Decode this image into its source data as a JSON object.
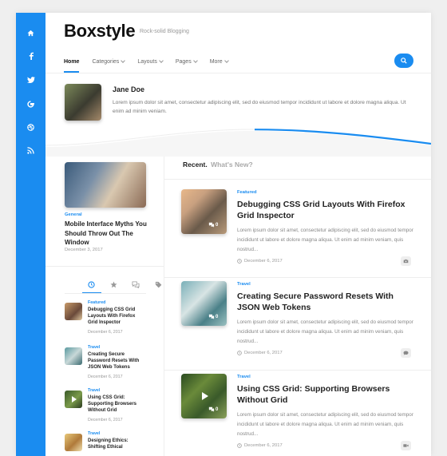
{
  "sidebar": {
    "icons": [
      "home-icon",
      "facebook-icon",
      "twitter-icon",
      "google-plus-icon",
      "dribbble-icon",
      "rss-icon"
    ]
  },
  "header": {
    "logo": "Boxstyle",
    "tagline": "Rock-solid Blogging"
  },
  "nav": {
    "items": [
      {
        "label": "Home",
        "has_dropdown": false,
        "active": true
      },
      {
        "label": "Categories",
        "has_dropdown": true
      },
      {
        "label": "Layouts",
        "has_dropdown": true
      },
      {
        "label": "Pages",
        "has_dropdown": true
      },
      {
        "label": "More",
        "has_dropdown": true
      }
    ],
    "search_icon": "search-icon"
  },
  "author": {
    "name": "Jane Doe",
    "bio": "Lorem ipsum dolor sit amet, consectetur adipiscing elit, sed do eiusmod tempor incididunt ut labore et dolore magna aliqua. Ut enim ad minim veniam."
  },
  "featured": {
    "category": "General",
    "title": "Mobile Interface Myths You Should Throw Out The Window",
    "date": "December 3, 2017"
  },
  "widget": {
    "tabs": [
      "clock-icon",
      "star-icon",
      "comments-icon",
      "tag-icon"
    ],
    "items": [
      {
        "category": "Featured",
        "title": "Debugging CSS Grid Layouts With Firefox Grid Inspector",
        "date": "December 6, 2017"
      },
      {
        "category": "Travel",
        "title": "Creating Secure Password Resets With JSON Web Tokens",
        "date": "December 6, 2017"
      },
      {
        "category": "Travel",
        "title": "Using CSS Grid: Supporting Browsers Without Grid",
        "date": "December 6, 2017"
      },
      {
        "category": "Travel",
        "title": "Designing Ethics: Shifting Ethical",
        "date": ""
      }
    ]
  },
  "recent": {
    "title": "Recent.",
    "subtitle": "What's New?"
  },
  "posts": [
    {
      "category": "Featured",
      "title": "Debugging CSS Grid Layouts With Firefox Grid Inspector",
      "excerpt": "Lorem ipsum dolor sit amet, consectetur adipiscing elit, sed do eiusmod tempor incididunt ut labore et dolore magna aliqua. Ut enim ad minim veniam, quis nostrud...",
      "date": "December 6, 2017",
      "comments": "0",
      "format_icon": "camera-icon"
    },
    {
      "category": "Travel",
      "title": "Creating Secure Password Resets With JSON Web Tokens",
      "excerpt": "Lorem ipsum dolor sit amet, consectetur adipiscing elit, sed do eiusmod tempor incididunt ut labore et dolore magna aliqua. Ut enim ad minim veniam, quis nostrud...",
      "date": "December 6, 2017",
      "comments": "0",
      "format_icon": "chat-icon"
    },
    {
      "category": "Travel",
      "title": "Using CSS Grid: Supporting Browsers Without Grid",
      "excerpt": "Lorem ipsum dolor sit amet, consectetur adipiscing elit, sed do eiusmod tempor incididunt ut labore et dolore magna aliqua. Ut enim ad minim veniam, quis nostrud...",
      "date": "December 6, 2017",
      "comments": "0",
      "format_icon": "video-icon"
    }
  ],
  "colors": {
    "accent": "#1a8cf0"
  }
}
